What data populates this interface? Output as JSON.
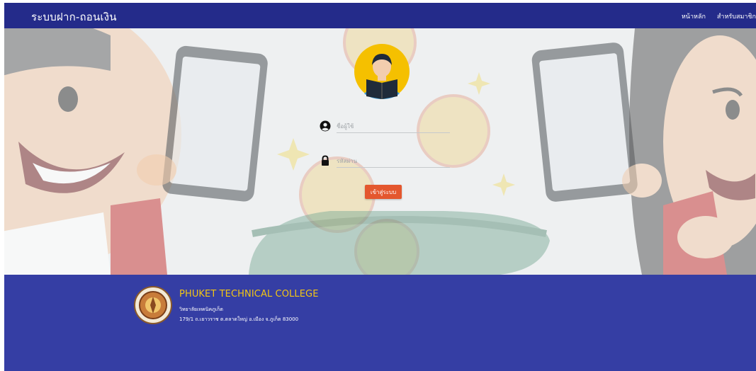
{
  "navbar": {
    "brand": "ระบบฝาก-ถอนเงิน",
    "links": [
      "หน้าหลัก",
      "สำหรับสมาชิก"
    ]
  },
  "login": {
    "username_placeholder": "ชื่อผู้ใช้",
    "password_placeholder": "รหัสผ่าน",
    "submit_label": "เข้าสู่ระบบ"
  },
  "footer": {
    "college_name": "PHUKET TECHNICAL COLLEGE",
    "college_name_th": "วิทยาลัยเทคนิคภูเก็ต",
    "address": "179/1 ถ.เยาวราช ต.ตลาดใหญ่ อ.เมือง จ.ภูเก็ต 83000"
  },
  "colors": {
    "navbar": "#242b8a",
    "footer": "#353ea4",
    "button": "#e4572e",
    "college_name": "#f3c614"
  }
}
